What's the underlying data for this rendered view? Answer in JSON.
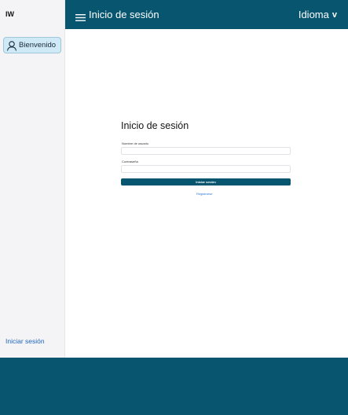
{
  "sidebar": {
    "brand": "IW",
    "welcome_label": "Bienvenido",
    "login_link": "Iniciar sesión"
  },
  "header": {
    "title": "Inicio de sesión",
    "language_label": "Idioma",
    "language_chevron": "v"
  },
  "form": {
    "title": "Inicio de sesión",
    "username_label": "Nombre de usuario",
    "username_value": "",
    "password_label": "Contraseña",
    "password_value": "",
    "submit_label": "Iniciar sesión",
    "register_link": "Registrarse"
  },
  "colors": {
    "primary": "#07556f",
    "sidebar_bg": "#f4f4f7",
    "welcome_bg": "#cfe9f6",
    "link": "#2066b8"
  },
  "icons": {
    "menu": "hamburger-icon",
    "user": "user-icon"
  }
}
